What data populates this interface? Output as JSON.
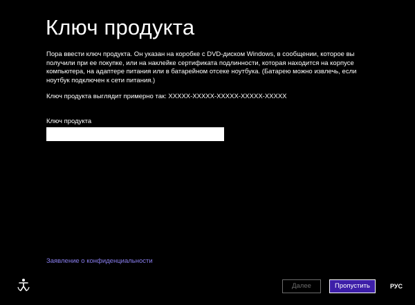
{
  "page": {
    "title": "Ключ продукта",
    "description": "Пора ввести ключ продукта. Он указан на коробке с DVD-диском Windows, в сообщении, которое вы получили при ее покупке, или на наклейке сертификата подлинности, которая находится на корпусе компьютера, на адаптере питания или в батарейном отсеке ноутбука. (Батарею можно извлечь, если ноутбук подключен к сети питания.)",
    "example": "Ключ продукта выглядит примерно так: XXXXX-XXXXX-XXXXX-XXXXX-XXXXX"
  },
  "form": {
    "label": "Ключ продукта",
    "value": "",
    "placeholder": ""
  },
  "links": {
    "privacy": "Заявление о конфиденциальности"
  },
  "footer": {
    "accessibility_icon": "ease-of-access-icon",
    "next_label": "Далее",
    "skip_label": "Пропустить",
    "language": "РУС"
  },
  "colors": {
    "background": "#000000",
    "accent": "#3d1ea8",
    "link": "#8a7ff0",
    "disabled": "#6d6d6d"
  }
}
